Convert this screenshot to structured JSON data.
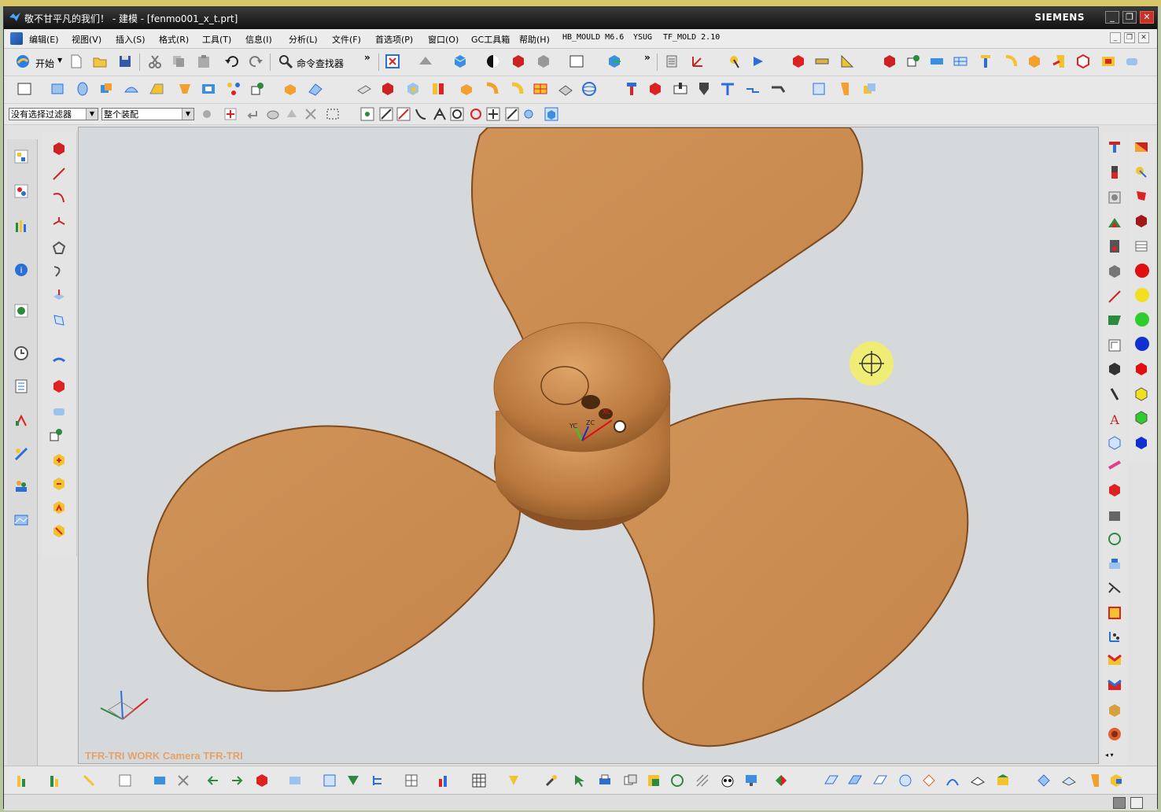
{
  "window": {
    "title": "敬不甘平凡的我们！ - 建模 - [fenmo001_x_t.prt]",
    "brand": "SIEMENS",
    "controls": {
      "minimize": "_",
      "restore": "❐",
      "close": "✕"
    }
  },
  "menu": {
    "items": [
      "编辑(E)",
      "视图(V)",
      "插入(S)",
      "格式(R)",
      "工具(T)",
      "信息(I)",
      "分析(L)",
      "文件(F)",
      "首选项(P)",
      "窗口(O)",
      "GC工具箱",
      "帮助(H)",
      "HB_MOULD M6.6",
      "YSUG",
      "TF_MOLD 2.10"
    ]
  },
  "toolbar": {
    "start_label": "开始",
    "command_finder_label": "命令查找器",
    "more_glyph": "»"
  },
  "selection_bar": {
    "filter_value": "没有选择过滤器",
    "scope_value": "整个装配"
  },
  "viewport": {
    "camera_label": "TFR-TRI WORK Camera TFR-TRI",
    "triad_labels": {
      "x": "XC",
      "y": "YC",
      "z": "ZC"
    },
    "model_color": "#c98a50",
    "background_color": "#d6d9dc"
  },
  "colors": {
    "accent_red": "#e01010",
    "accent_yellow": "#f0e020",
    "accent_green": "#2ecc2e",
    "accent_blue": "#1030d0",
    "cursor_highlight": "#f2ee6a"
  }
}
